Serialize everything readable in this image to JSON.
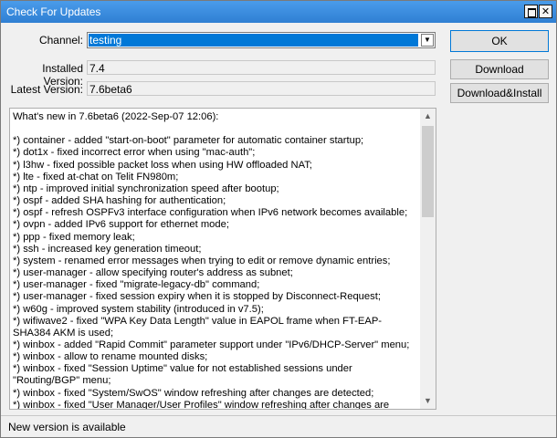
{
  "window": {
    "title": "Check For Updates",
    "close_glyph": "✕"
  },
  "form": {
    "channel_label": "Channel:",
    "channel_value": "testing",
    "installed_label": "Installed Version:",
    "installed_value": "7.4",
    "latest_label": "Latest Version:",
    "latest_value": "7.6beta6"
  },
  "buttons": {
    "ok": "OK",
    "download": "Download",
    "download_install": "Download&Install"
  },
  "notes": {
    "text": "What's new in 7.6beta6 (2022-Sep-07 12:06):\n\n*) container - added \"start-on-boot\" parameter for automatic container startup;\n*) dot1x - fixed incorrect error when using \"mac-auth\";\n*) l3hw - fixed possible packet loss when using HW offloaded NAT;\n*) lte - fixed at-chat on Telit FN980m;\n*) ntp - improved initial synchronization speed after bootup;\n*) ospf - added SHA hashing for authentication;\n*) ospf - refresh OSPFv3 interface configuration when IPv6 network becomes available;\n*) ovpn - added IPv6 support for ethernet mode;\n*) ppp - fixed memory leak;\n*) ssh - increased key generation timeout;\n*) system - renamed error messages when trying to edit or remove dynamic entries;\n*) user-manager - allow specifying router's address as subnet;\n*) user-manager - fixed \"migrate-legacy-db\" command;\n*) user-manager - fixed session expiry when it is stopped by Disconnect-Request;\n*) w60g - improved system stability (introduced in v7.5);\n*) wifiwave2 - fixed \"WPA Key Data Length\" value in EAPOL frame when FT-EAP-SHA384 AKM is used;\n*) winbox - added \"Rapid Commit\" parameter support under \"IPv6/DHCP-Server\" menu;\n*) winbox - allow to rename mounted disks;\n*) winbox - fixed \"Session Uptime\" value for not established sessions under \"Routing/BGP\" menu;\n*) winbox - fixed \"System/SwOS\" window refreshing after changes are detected;\n*) winbox - fixed \"User Manager/User Profiles\" window refreshing after changes are detected;"
  },
  "status": {
    "text": "New version is available"
  }
}
